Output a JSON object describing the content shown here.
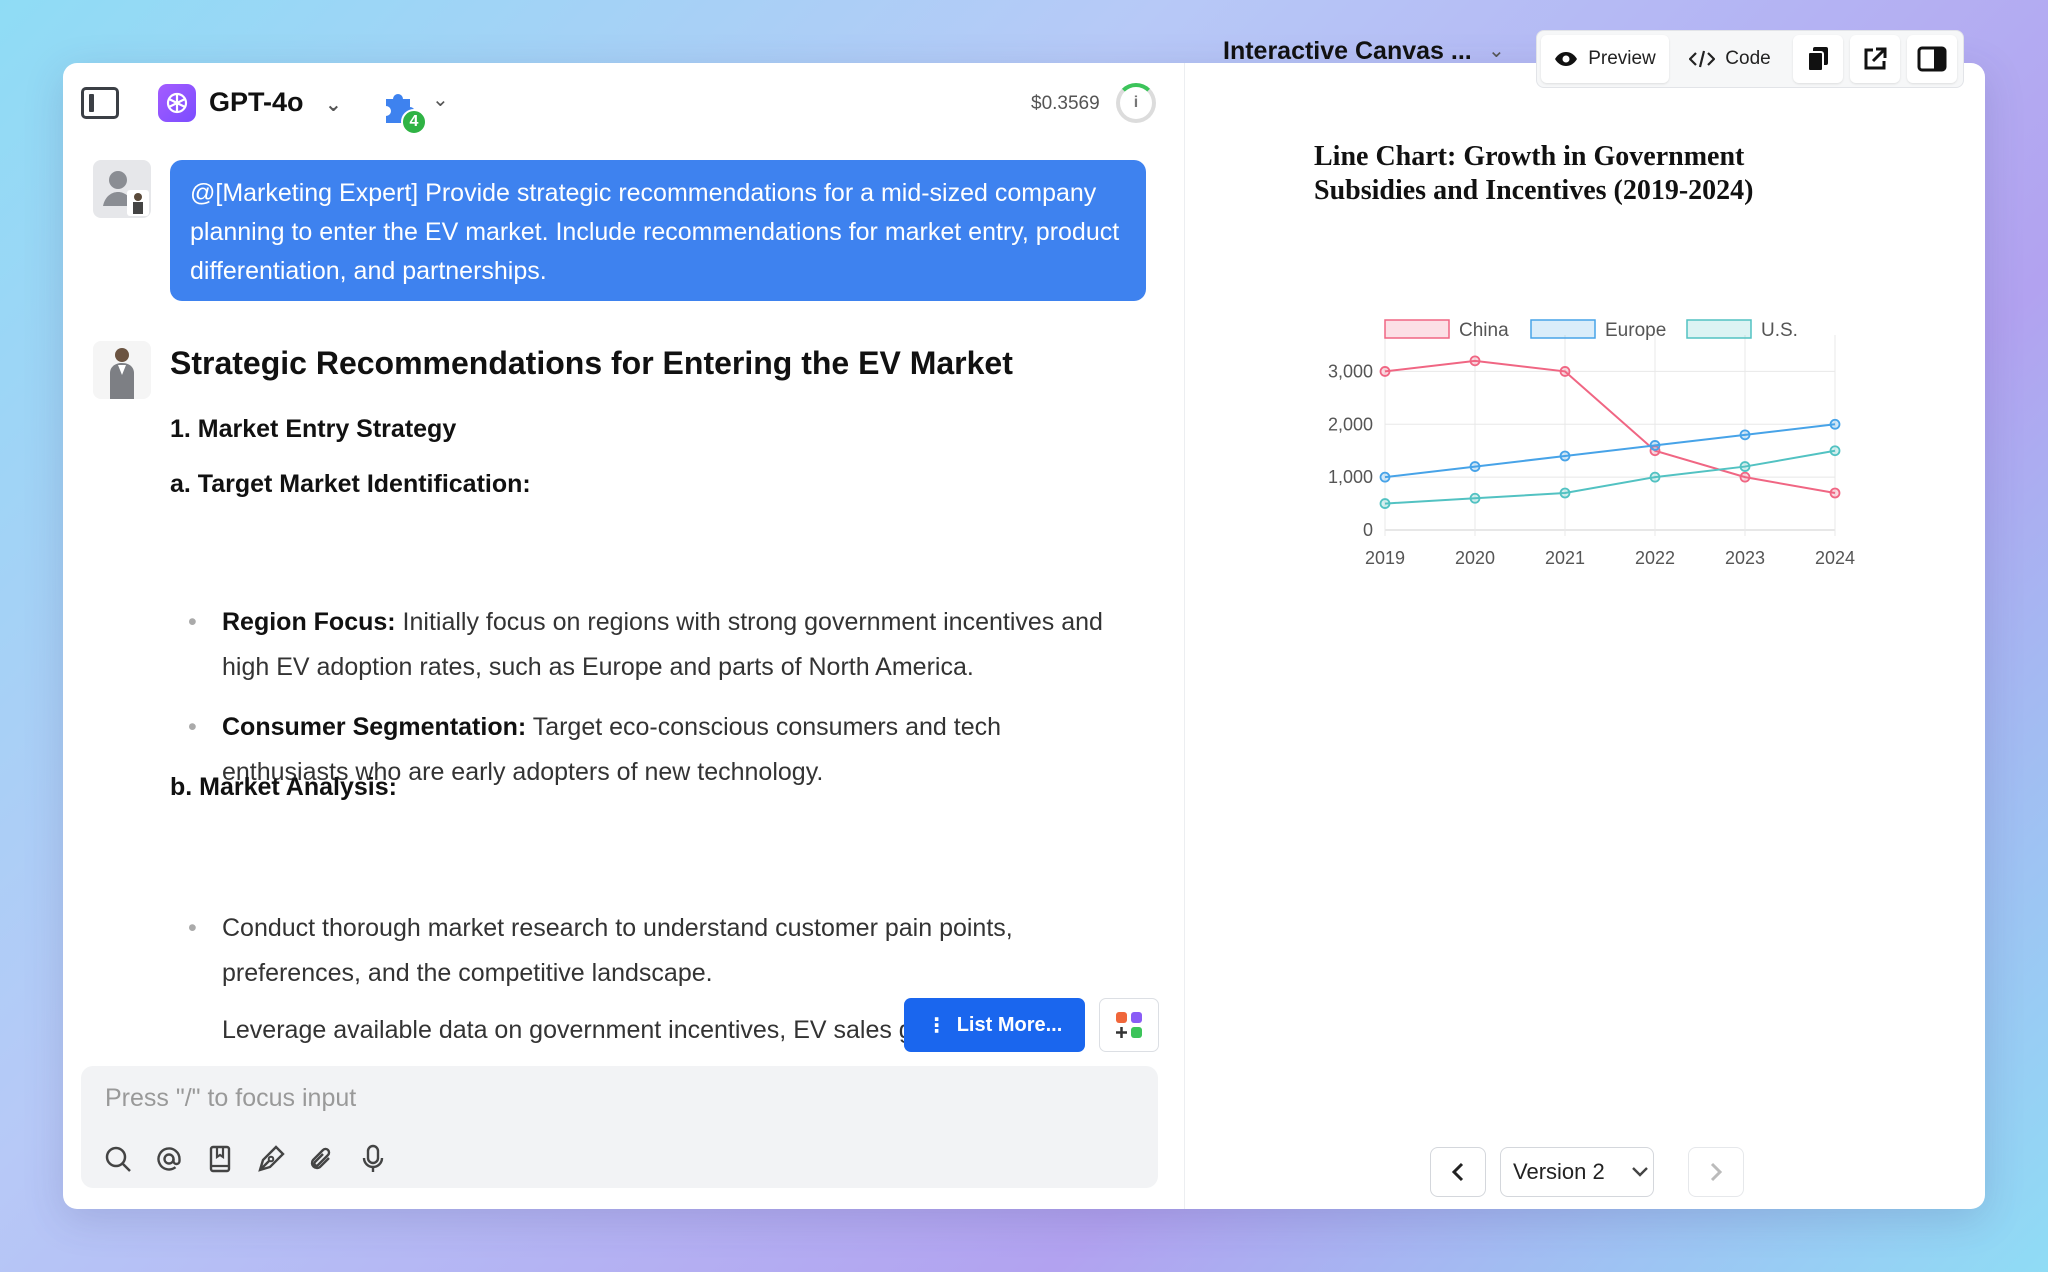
{
  "header": {
    "model_name": "GPT-4o",
    "plugin_count": "4",
    "cost": "$0.3569",
    "cost_info_icon": "i"
  },
  "user_message": {
    "text": "@[Marketing Expert] Provide strategic recommendations for a mid-sized company planning to enter the EV market. Include recommendations for market entry, product differentiation, and partnerships."
  },
  "assistant_message": {
    "title": "Strategic Recommendations for Entering the EV Market",
    "section1": "1. Market Entry Strategy",
    "sub_a": "a. Target Market Identification:",
    "bullets_a": [
      {
        "label": "Region Focus:",
        "text": " Initially focus on regions with strong government incentives and high EV adoption rates, such as Europe and parts of North America."
      },
      {
        "label": "Consumer Segmentation:",
        "text": " Target eco-conscious consumers and tech enthusiasts who are early adopters of new technology."
      }
    ],
    "sub_b": "b. Market Analysis:",
    "bullets_b": [
      "Conduct thorough market research to understand customer pain points, preferences, and the competitive landscape.",
      "Leverage available data on government incentives, EV sales growth, and"
    ]
  },
  "actions": {
    "list_more": "List More..."
  },
  "input": {
    "placeholder": "Press \"/\" to focus input"
  },
  "canvas": {
    "title": "Interactive Canvas ...",
    "preview_label": "Preview",
    "code_label": "Code"
  },
  "chart_data": {
    "type": "line",
    "title_line1": "Line Chart: Growth in Government",
    "title_line2": "Subsidies and Incentives (2019-2024)",
    "categories": [
      "2019",
      "2020",
      "2021",
      "2022",
      "2023",
      "2024"
    ],
    "series": [
      {
        "name": "China",
        "color": "#f06683",
        "values": [
          3000,
          3200,
          3000,
          1500,
          1000,
          700
        ]
      },
      {
        "name": "Europe",
        "color": "#47a3e8",
        "values": [
          1000,
          1200,
          1400,
          1600,
          1800,
          2000
        ]
      },
      {
        "name": "U.S.",
        "color": "#52c2c2",
        "values": [
          500,
          600,
          700,
          1000,
          1200,
          1500
        ]
      }
    ],
    "yticks": [
      0,
      1000,
      2000,
      3000
    ],
    "ytick_labels": [
      "0",
      "1,000",
      "2,000",
      "3,000"
    ],
    "ylim": [
      0,
      3500
    ],
    "grid": true,
    "legend": "top"
  },
  "versions": {
    "current": "Version 2"
  },
  "colors": {
    "accent": "#3e82ef",
    "button": "#1a66ee"
  }
}
